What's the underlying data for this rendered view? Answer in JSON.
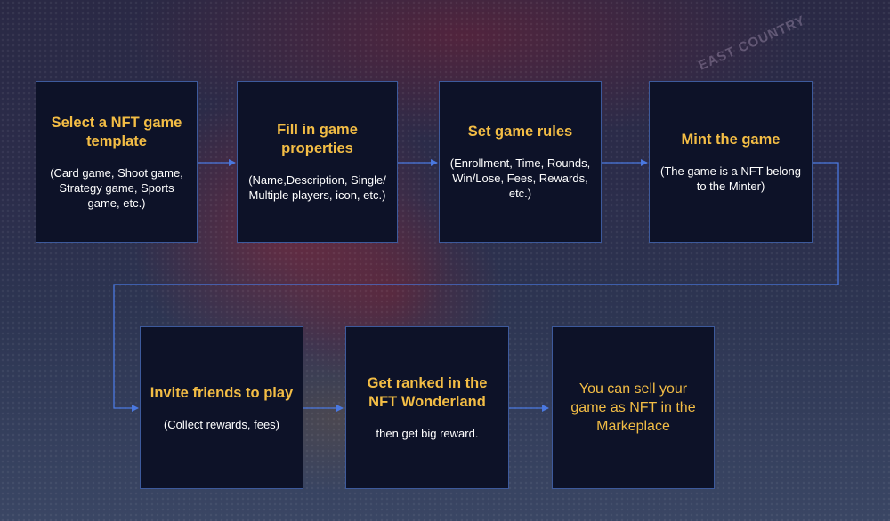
{
  "background": {
    "watermark_text": "EAST COUNTRY"
  },
  "colors": {
    "box_fill": "#0d1228",
    "box_border": "#3d5a9c",
    "title": "#f3bd45",
    "text": "#ffffff",
    "arrow": "#4a78e0"
  },
  "steps": [
    {
      "title": "Select a NFT game template",
      "description": "(Card game, Shoot game, Strategy game, Sports game, etc.)"
    },
    {
      "title": "Fill in game properties",
      "description": "(Name,Description, Single/ Multiple players, icon, etc.)"
    },
    {
      "title": "Set game rules",
      "description": "(Enrollment, Time, Rounds, Win/Lose, Fees, Rewards, etc.)"
    },
    {
      "title": "Mint the game",
      "description": "(The game is a NFT belong to the Minter)"
    },
    {
      "title": "Invite friends to play",
      "description": "(Collect rewards, fees)"
    },
    {
      "title": "Get ranked in the NFT Wonderland",
      "description": "then get big reward."
    },
    {
      "title": "You can sell your game as NFT in the Markeplace"
    }
  ]
}
